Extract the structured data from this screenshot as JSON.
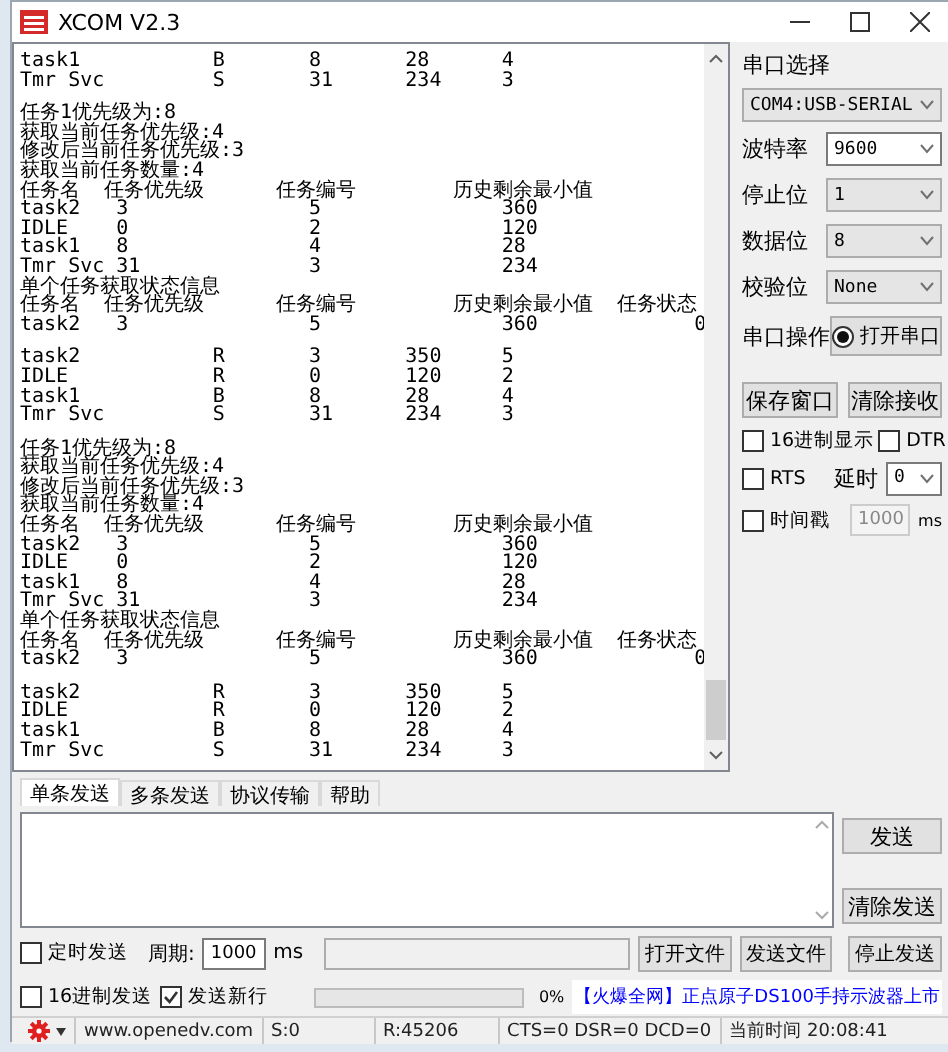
{
  "window": {
    "title": "XCOM V2.3"
  },
  "log": {
    "blocks": [
      [
        "task1           B       8       28      4",
        "Tmr Svc         S       31      234     3"
      ],
      [
        "任务1优先级为:8",
        "获取当前任务优先级:4",
        "修改后当前任务优先级:3",
        "获取当前任务数量:4",
        "任务名  任务优先级      任务编号        历史剩余最小值",
        "task2   3               5               360",
        "IDLE    0               2               120",
        "task1   8               4               28",
        "Tmr Svc 31              3               234",
        "单个任务获取状态信息",
        "任务名  任务优先级      任务编号        历史剩余最小值  任务状态",
        "task2   3               5               360             0"
      ],
      [
        "task2           R       3       350     5",
        "IDLE            R       0       120     2",
        "task1           B       8       28      4",
        "Tmr Svc         S       31      234     3"
      ],
      [
        "任务1优先级为:8",
        "获取当前任务优先级:4",
        "修改后当前任务优先级:3",
        "获取当前任务数量:4",
        "任务名  任务优先级      任务编号        历史剩余最小值",
        "task2   3               5               360",
        "IDLE    0               2               120",
        "task1   8               4               28",
        "Tmr Svc 31              3               234",
        "单个任务获取状态信息",
        "任务名  任务优先级      任务编号        历史剩余最小值  任务状态",
        "task2   3               5               360             0"
      ],
      [
        "task2           R       3       350     5",
        "IDLE            R       0       120     2",
        "task1           B       8       28      4",
        "Tmr Svc         S       31      234     3"
      ]
    ]
  },
  "serial_panel": {
    "port_label": "串口选择",
    "port": "COM4:USB-SERIAL",
    "settings": [
      {
        "label": "波特率",
        "value": "9600",
        "editable": true
      },
      {
        "label": "停止位",
        "value": "1",
        "editable": false
      },
      {
        "label": "数据位",
        "value": "8",
        "editable": false
      },
      {
        "label": "校验位",
        "value": "None",
        "editable": false
      }
    ],
    "operation_label": "串口操作",
    "open_button": "打开串口",
    "buttons": [
      "保存窗口",
      "清除接收"
    ],
    "hex_display": {
      "label": "16进制显示",
      "checked": false
    },
    "dtr": {
      "label": "DTR",
      "checked": false
    },
    "rts": {
      "label": "RTS",
      "checked": false
    },
    "delay_label": "延时",
    "delay": "0",
    "timestamp": {
      "label": "时间戳",
      "checked": false
    },
    "timestamp_interval": "1000",
    "timestamp_unit": "ms"
  },
  "send": {
    "tabs": [
      {
        "label": "单条发送",
        "selected": true
      },
      {
        "label": "多条发送",
        "selected": false
      },
      {
        "label": "协议传输",
        "selected": false
      },
      {
        "label": "帮助",
        "selected": false
      }
    ],
    "buttons": [
      "发送",
      "清除发送"
    ],
    "timed_send": {
      "label": "定时发送",
      "checked": false
    },
    "period_label": "周期:",
    "period": "1000",
    "period_unit": "ms",
    "file_buttons": [
      "打开文件",
      "发送文件",
      "停止发送"
    ],
    "hex_send": {
      "label": "16进制发送",
      "checked": false
    },
    "newline": {
      "label": "发送新行",
      "checked": true
    },
    "progress": {
      "level": 0,
      "reading": "0%"
    },
    "ad_link": "【火爆全网】正点原子DS100手持示波器上市"
  },
  "status_bar": {
    "website": "www.openedv.com",
    "sent": "S:0",
    "received": "R:45206",
    "lines": "CTS=0 DSR=0 DCD=0",
    "time": "当前时间 20:08:41"
  }
}
